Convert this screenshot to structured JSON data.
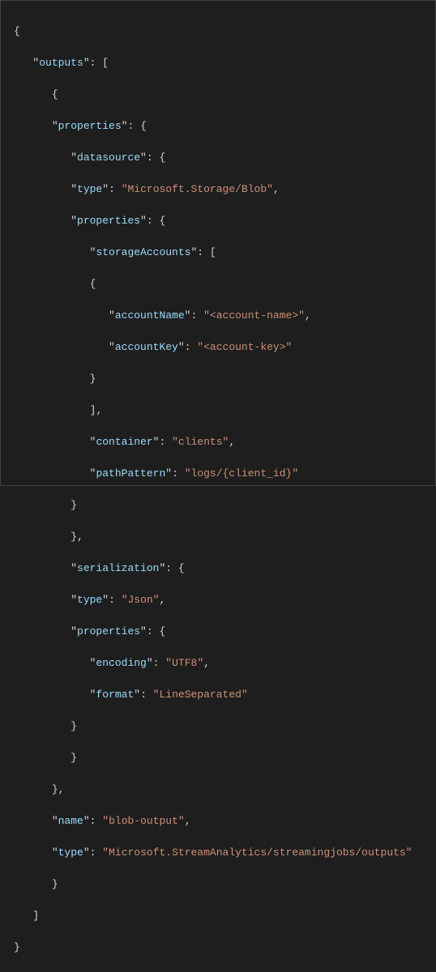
{
  "code": {
    "k_outputs": "outputs",
    "k_properties": "properties",
    "k_datasource": "datasource",
    "k_type": "type",
    "v_msStorageBlob": "Microsoft.Storage/Blob",
    "k_storageAccounts": "storageAccounts",
    "k_accountName": "accountName",
    "v_accountName": "<account-name>",
    "k_accountKey": "accountKey",
    "v_accountKey": "<account-key>",
    "k_container": "container",
    "v_container": "clients",
    "k_pathPattern": "pathPattern",
    "v_pathPattern": "logs/{client_id}",
    "k_serialization": "serialization",
    "v_json": "Json",
    "k_encoding": "encoding",
    "v_encoding": "UTF8",
    "k_format": "format",
    "v_format": "LineSeparated",
    "k_name": "name",
    "v_name": "blob-output",
    "v_typeFull": "Microsoft.StreamAnalytics/streamingjobs/outputs"
  }
}
